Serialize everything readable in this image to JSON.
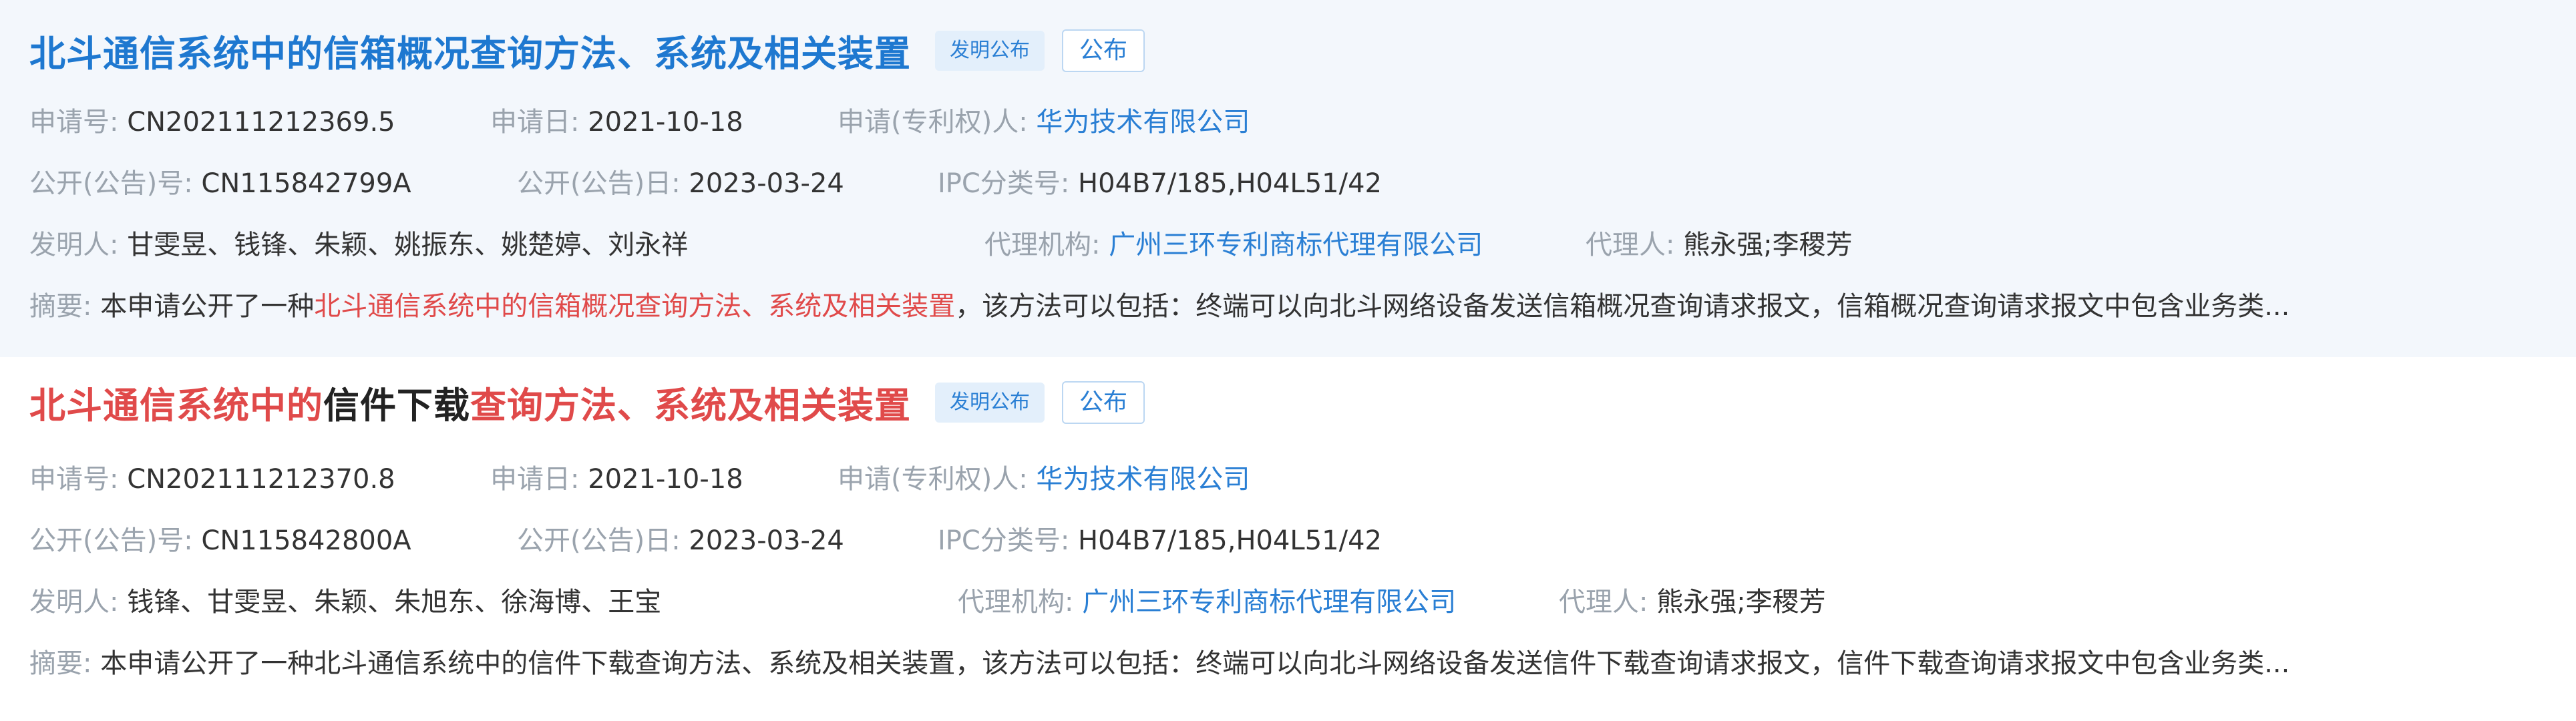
{
  "records": [
    {
      "title_segments": [
        "北斗通信系统中的信箱概况查询方法、系统及相关装置"
      ],
      "type_badge": "发明公布",
      "status_badge": "公布",
      "app_no_label": "申请号:",
      "app_no": "CN202111212369.5",
      "app_date_label": "申请日:",
      "app_date": "2021-10-18",
      "applicant_label": "申请(专利权)人:",
      "applicant": "华为技术有限公司",
      "pub_no_label": "公开(公告)号:",
      "pub_no": "CN115842799A",
      "pub_date_label": "公开(公告)日:",
      "pub_date": "2023-03-24",
      "ipc_label": "IPC分类号:",
      "ipc": "H04B7/185,H04L51/42",
      "inventor_label": "发明人:",
      "inventors": "甘雯昱、钱锋、朱颖、姚振东、姚楚婷、刘永祥",
      "agency_label": "代理机构:",
      "agency": "广州三环专利商标代理有限公司",
      "agent_label": "代理人:",
      "agents": "熊永强;李稷芳",
      "abstract_label": "摘要:",
      "abstract_pre": "本申请公开了一种",
      "abstract_hl": "北斗通信系统中的信箱概况查询方法、系统及相关装置",
      "abstract_post": "，该方法可以包括：终端可以向北斗网络设备发送信箱概况查询请求报文，信箱概况查询请求报文中包含业务类..."
    },
    {
      "title_segments": [
        "北斗通信系统中的",
        "信件下载",
        "查询方法、系统及相关装置"
      ],
      "type_badge": "发明公布",
      "status_badge": "公布",
      "app_no_label": "申请号:",
      "app_no": "CN202111212370.8",
      "app_date_label": "申请日:",
      "app_date": "2021-10-18",
      "applicant_label": "申请(专利权)人:",
      "applicant": "华为技术有限公司",
      "pub_no_label": "公开(公告)号:",
      "pub_no": "CN115842800A",
      "pub_date_label": "公开(公告)日:",
      "pub_date": "2023-03-24",
      "ipc_label": "IPC分类号:",
      "ipc": "H04B7/185,H04L51/42",
      "inventor_label": "发明人:",
      "inventors": "钱锋、甘雯昱、朱颖、朱旭东、徐海博、王宝",
      "agency_label": "代理机构:",
      "agency": "广州三环专利商标代理有限公司",
      "agent_label": "代理人:",
      "agents": "熊永强;李稷芳",
      "abstract_label": "摘要:",
      "abstract_text": "本申请公开了一种北斗通信系统中的信件下载查询方法、系统及相关装置，该方法可以包括：终端可以向北斗网络设备发送信件下载查询请求报文，信件下载查询请求报文中包含业务类..."
    }
  ]
}
